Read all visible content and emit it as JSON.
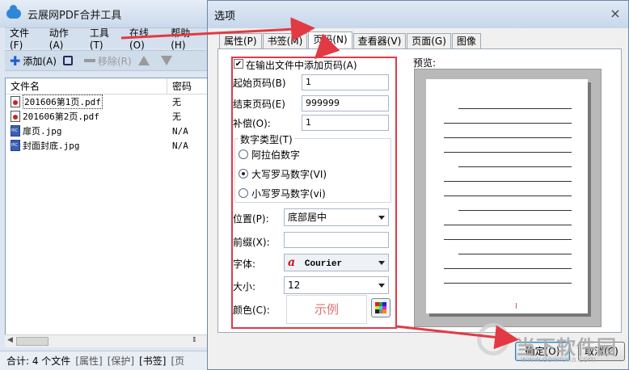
{
  "app": {
    "title": "云展网PDF合并工具",
    "menu": [
      "文件(F)",
      "动作(A)",
      "工具(T)",
      "在线(O)",
      "帮助(H)"
    ],
    "toolbar": {
      "add": "添加(A)",
      "remove": "移除(R)"
    },
    "file_list": {
      "columns": [
        "文件名",
        "密码"
      ],
      "rows": [
        {
          "name": "201606第1页.pdf",
          "password": "无",
          "type": "pdf"
        },
        {
          "name": "201606第2页.pdf",
          "password": "无",
          "type": "pdf"
        },
        {
          "name": "扉页.jpg",
          "password": "N/A",
          "type": "image"
        },
        {
          "name": "封面封底.jpg",
          "password": "N/A",
          "type": "image"
        }
      ]
    },
    "status": {
      "total": "合计: 4 个文件",
      "props": "[属性]",
      "protect": "[保护]",
      "bookmark": "[书签]",
      "page": "[页"
    }
  },
  "dialog": {
    "title": "选项",
    "close": "×",
    "tabs": [
      "属性(P)",
      "书签(M)",
      "页码(N)",
      "查看器(V)",
      "页面(G)",
      "图像"
    ],
    "active_tab": "页码(N)",
    "pagenum": {
      "add_checkbox_label": "在输出文件中添加页码(A)",
      "add_checked": true,
      "start_label": "起始页码(B)",
      "start_value": "1",
      "end_label": "结束页码(E)",
      "end_value": "999999",
      "offset_label": "补偿(O):",
      "offset_value": "1",
      "numtype_label": "数字类型(T)",
      "numtypes": [
        "阿拉伯数字",
        "大写罗马数字(VI)",
        "小写罗马数字(vi)"
      ],
      "numtype_selected": 1,
      "position_label": "位置(P):",
      "position_value": "底部居中",
      "prefix_label": "前缀(X):",
      "prefix_value": "",
      "font_label": "字体:",
      "font_value": "Courier",
      "size_label": "大小:",
      "size_value": "12",
      "color_label": "颜色(C):",
      "sample_text": "示例"
    },
    "preview": {
      "label": "预览:",
      "page_number": "I"
    },
    "buttons": {
      "ok": "确定(O)",
      "cancel": "取消(C)"
    }
  },
  "watermark": {
    "brand": "当下软件园",
    "url": "www.downxia.com"
  },
  "colors": {
    "highlight": "#e23a44",
    "accent": "#3c7fb1"
  }
}
